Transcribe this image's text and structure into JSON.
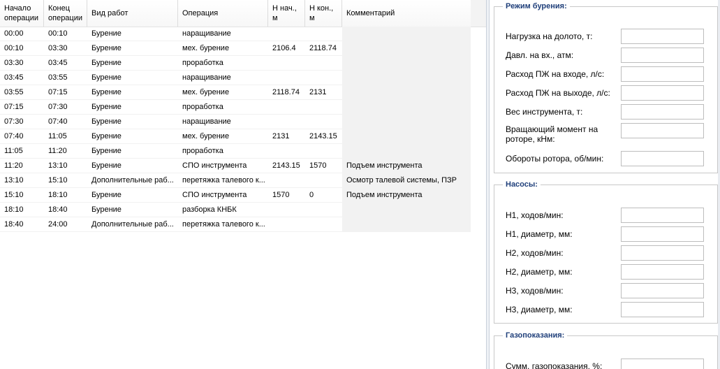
{
  "grid": {
    "columns": [
      {
        "key": "start",
        "label": "Начало\nоперации"
      },
      {
        "key": "end",
        "label": "Конец\nоперации"
      },
      {
        "key": "type",
        "label": "Вид работ"
      },
      {
        "key": "op",
        "label": "Операция"
      },
      {
        "key": "hstart",
        "label": "Н нач.,\nм"
      },
      {
        "key": "hend",
        "label": "Н кон.,\nм"
      },
      {
        "key": "comment",
        "label": "Комментарий"
      }
    ],
    "rows": [
      {
        "start": "00:00",
        "end": "00:10",
        "type": "Бурение",
        "op": "наращивание",
        "hstart": "",
        "hend": "",
        "comment": ""
      },
      {
        "start": "00:10",
        "end": "03:30",
        "type": "Бурение",
        "op": "мех. бурение",
        "hstart": "2106.4",
        "hend": "2118.74",
        "comment": ""
      },
      {
        "start": "03:30",
        "end": "03:45",
        "type": "Бурение",
        "op": "проработка",
        "hstart": "",
        "hend": "",
        "comment": ""
      },
      {
        "start": "03:45",
        "end": "03:55",
        "type": "Бурение",
        "op": "наращивание",
        "hstart": "",
        "hend": "",
        "comment": ""
      },
      {
        "start": "03:55",
        "end": "07:15",
        "type": "Бурение",
        "op": "мех. бурение",
        "hstart": "2118.74",
        "hend": "2131",
        "comment": ""
      },
      {
        "start": "07:15",
        "end": "07:30",
        "type": "Бурение",
        "op": "проработка",
        "hstart": "",
        "hend": "",
        "comment": ""
      },
      {
        "start": "07:30",
        "end": "07:40",
        "type": "Бурение",
        "op": "наращивание",
        "hstart": "",
        "hend": "",
        "comment": ""
      },
      {
        "start": "07:40",
        "end": "11:05",
        "type": "Бурение",
        "op": "мех. бурение",
        "hstart": "2131",
        "hend": "2143.15",
        "comment": ""
      },
      {
        "start": "11:05",
        "end": "11:20",
        "type": "Бурение",
        "op": "проработка",
        "hstart": "",
        "hend": "",
        "comment": ""
      },
      {
        "start": "11:20",
        "end": "13:10",
        "type": "Бурение",
        "op": "СПО инструмента",
        "hstart": "2143.15",
        "hend": "1570",
        "comment": "Подъем инструмента"
      },
      {
        "start": "13:10",
        "end": "15:10",
        "type": "Дополнительные раб...",
        "op": "перетяжка талевого к...",
        "hstart": "",
        "hend": "",
        "comment": "Осмотр талевой системы, ПЗР"
      },
      {
        "start": "15:10",
        "end": "18:10",
        "type": "Бурение",
        "op": "СПО инструмента",
        "hstart": "1570",
        "hend": "0",
        "comment": "Подъем инструмента"
      },
      {
        "start": "18:10",
        "end": "18:40",
        "type": "Бурение",
        "op": "разборка КНБК",
        "hstart": "",
        "hend": "",
        "comment": ""
      },
      {
        "start": "18:40",
        "end": "24:00",
        "type": "Дополнительные раб...",
        "op": "перетяжка талевого к...",
        "hstart": "",
        "hend": "",
        "comment": ""
      }
    ]
  },
  "panel": {
    "drilling": {
      "title": "Режим бурения:",
      "fields": [
        {
          "label": "Нагрузка на долото, т:",
          "value": ""
        },
        {
          "label": "Давл. на вх., атм:",
          "value": ""
        },
        {
          "label": "Расход ПЖ на входе, л/с:",
          "value": ""
        },
        {
          "label": "Расход ПЖ на выходе, л/с:",
          "value": ""
        },
        {
          "label": "Вес инструмента, т:",
          "value": ""
        },
        {
          "label": "Вращающий момент на\nроторе, кНм:",
          "value": ""
        },
        {
          "label": "Обороты ротора, об/мин:",
          "value": ""
        }
      ]
    },
    "pumps": {
      "title": "Насосы:",
      "fields": [
        {
          "label": "Н1, ходов/мин:",
          "value": ""
        },
        {
          "label": "Н1, диаметр, мм:",
          "value": ""
        },
        {
          "label": "Н2, ходов/мин:",
          "value": ""
        },
        {
          "label": "Н2, диаметр, мм:",
          "value": ""
        },
        {
          "label": "Н3, ходов/мин:",
          "value": ""
        },
        {
          "label": "Н3, диаметр, мм:",
          "value": ""
        }
      ]
    },
    "gas": {
      "title": "Газопоказания:",
      "fields": [
        {
          "label": "Сумм. газопоказания, %:",
          "value": ""
        }
      ]
    }
  }
}
